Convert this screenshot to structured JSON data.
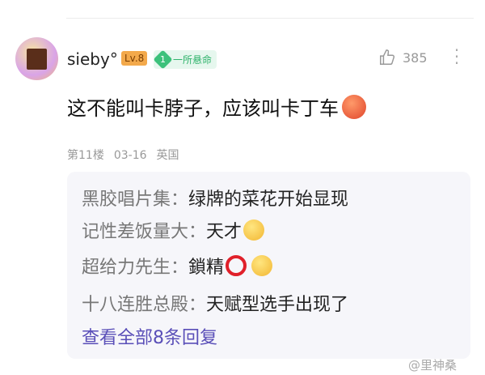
{
  "comment": {
    "username": "sieby°",
    "level": "Lv.8",
    "badge_number": "1",
    "badge_text": "一所悬命",
    "likes": "385",
    "text": "这不能叫卡脖子，应该叫卡丁车",
    "floor": "第11楼",
    "date": "03-16",
    "location": "英国"
  },
  "replies": [
    {
      "name": "黑胶唱片集：",
      "text": "绿牌的菜花开始显现"
    },
    {
      "name": "记性差饭量大：",
      "text": "天才"
    },
    {
      "name": "超给力先生：",
      "text": "鎖精"
    },
    {
      "name": "十八连胜总殿：",
      "text": "天赋型选手出现了"
    }
  ],
  "view_all": "查看全部8条回复",
  "watermark": "@里神桑"
}
